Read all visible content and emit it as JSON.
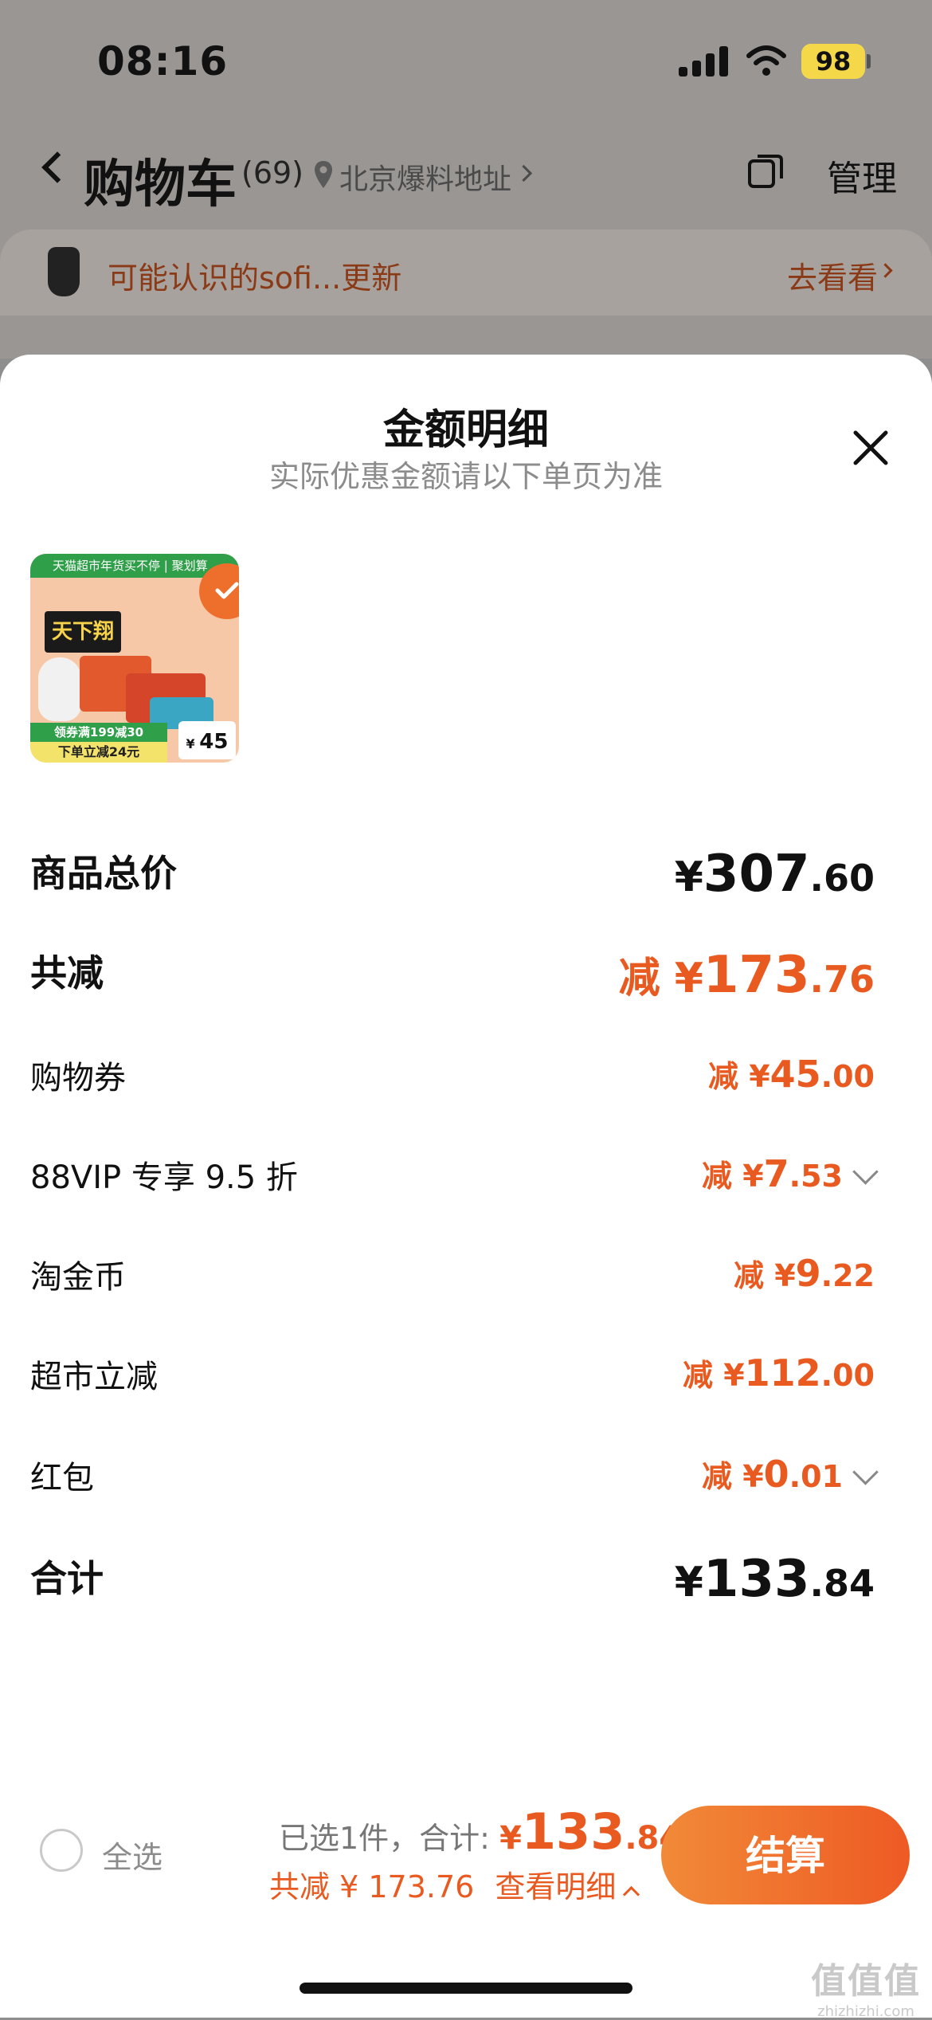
{
  "status_bar": {
    "time": "08:16",
    "battery": "98"
  },
  "nav": {
    "title": "购物车",
    "count": "(69)",
    "address": "北京爆料地址",
    "manage_label": "管理"
  },
  "notice": {
    "text": "可能认识的sofi...更新",
    "link": "去看看"
  },
  "sheet": {
    "title": "金额明细",
    "subtitle": "实际优惠金额请以下单页为准",
    "product_thumbnail": {
      "top_banner": "天猫超市年货买不停 | 聚划算",
      "brand": "天下翔",
      "promo_bar": "领券满199减30",
      "promo_bottom": "下单立减24元",
      "price": "45"
    },
    "rows": [
      {
        "label": "商品总价",
        "prefix": "",
        "yen": "¥",
        "integer": "307",
        "decimal": ".60"
      },
      {
        "label": "共减",
        "prefix": "减 ",
        "yen": "¥",
        "integer": "173",
        "decimal": ".76"
      },
      {
        "label": "购物券",
        "prefix": "减 ",
        "yen": "¥",
        "integer": "45",
        "decimal": ".00"
      },
      {
        "label": "88VIP 专享 9.5 折",
        "prefix": "减 ",
        "yen": "¥",
        "integer": "7",
        "decimal": ".53"
      },
      {
        "label": "淘金币",
        "prefix": "减 ",
        "yen": "¥",
        "integer": "9",
        "decimal": ".22"
      },
      {
        "label": "超市立减",
        "prefix": "减 ",
        "yen": "¥",
        "integer": "112",
        "decimal": ".00"
      },
      {
        "label": "红包",
        "prefix": "减 ",
        "yen": "¥",
        "integer": "0",
        "decimal": ".01"
      },
      {
        "label": "合计",
        "prefix": "",
        "yen": "¥",
        "integer": "133",
        "decimal": ".84"
      }
    ]
  },
  "bottom_bar": {
    "select_all": "全选",
    "selected_text": "已选1件，合计:",
    "total_yen": "¥",
    "total_integer": "133",
    "total_decimal": ".84",
    "saving_text": "共减 ¥ 173.76",
    "detail_link": "查看明细",
    "checkout": "结算"
  },
  "watermark": {
    "logo": "值值值",
    "url": "zhizhizhi.com"
  },
  "colors": {
    "accent": "#e85a20",
    "button_start": "#f18a38",
    "button_end": "#ee5a24",
    "overlay": "#9a9694"
  }
}
